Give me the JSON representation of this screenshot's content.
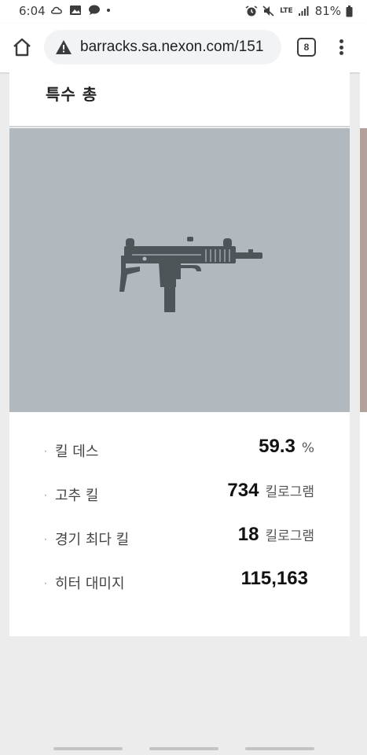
{
  "status_bar": {
    "time": "6:04",
    "network": "LTE",
    "battery": "81%"
  },
  "browser": {
    "url": "barracks.sa.nexon.com/151",
    "tab_count": "8"
  },
  "card": {
    "title": "특수 총",
    "stats": [
      {
        "label": "킬 데스",
        "value": "59.3",
        "unit": "%"
      },
      {
        "label": "고추 킬",
        "value": "734",
        "unit": "킬로그램"
      },
      {
        "label": "경기 최다 킬",
        "value": "18",
        "unit": "킬로그램"
      },
      {
        "label": "히터 대미지",
        "value": "115,163",
        "unit": ""
      }
    ],
    "bullet": "·"
  },
  "colors": {
    "weapon_panel_bg": "#b2b9be",
    "weapon_silhouette": "#4e5559",
    "peek_panel_bg": "#b3a19e"
  },
  "icons": {
    "home": "home-icon",
    "warning": "warning-icon",
    "menu": "more-vert-icon",
    "weapon": "uzi-smg-icon"
  }
}
